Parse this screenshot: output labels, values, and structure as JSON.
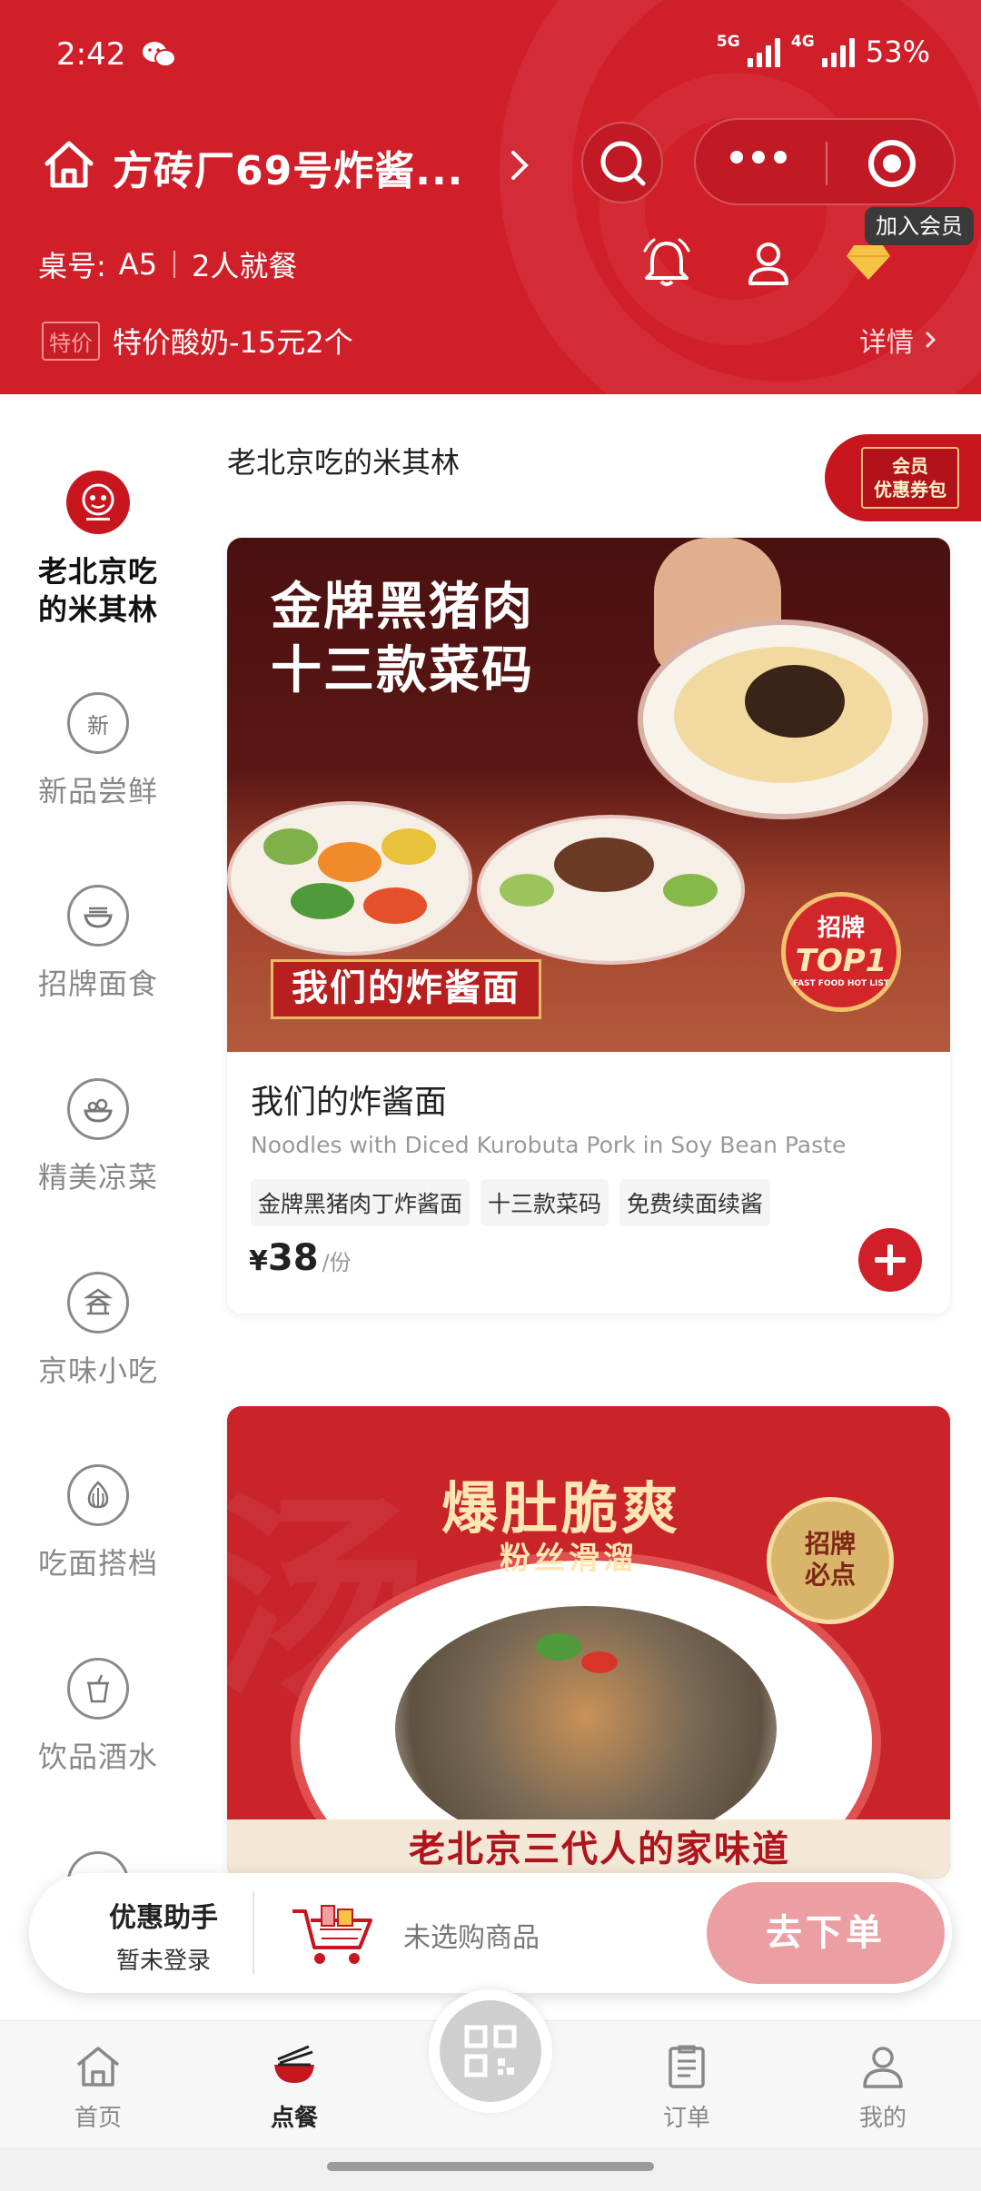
{
  "status_bar": {
    "time": "2:42",
    "net1": "5G",
    "net2": "4G",
    "battery": "53%"
  },
  "header": {
    "store_name": "方砖厂69号炸酱...",
    "join_member": "加入会员",
    "table_label": "桌号:",
    "table_no": "A5",
    "diners": "2人就餐",
    "promo_tag": "特价",
    "promo_text": "特价酸奶-15元2个",
    "details": "详情"
  },
  "sidebar": {
    "items": [
      {
        "label": "老北京吃的米其林",
        "icon": "restaurant-logo-icon",
        "active": true
      },
      {
        "label": "新品尝鲜",
        "icon_text": "新"
      },
      {
        "label": "招牌面食",
        "icon": "noodle-bowl-icon"
      },
      {
        "label": "精美凉菜",
        "icon": "salad-bowl-icon"
      },
      {
        "label": "京味小吃",
        "icon": "temple-icon"
      },
      {
        "label": "吃面搭档",
        "icon": "garlic-icon"
      },
      {
        "label": "饮品酒水",
        "icon": "drink-cup-icon"
      }
    ]
  },
  "main": {
    "section_title": "老北京吃的米其林",
    "coupon_label": "会员\n优惠券包",
    "dish1": {
      "image_title_line1": "金牌黑猪肉",
      "image_title_line2": "十三款菜码",
      "image_ribbon": "我们的炸酱面",
      "image_badge_line1": "招牌",
      "image_badge_line2": "TOP1",
      "image_badge_line3": "FAST FOOD HOT LIST",
      "name": "我们的炸酱面",
      "name_en": "Noodles with Diced Kurobuta Pork in Soy Bean Paste",
      "tags": [
        "金牌黑猪肉丁炸酱面",
        "十三款菜码",
        "免费续面续酱"
      ],
      "price_symbol": "¥",
      "price": "38",
      "unit": "/份"
    },
    "dish2": {
      "image_title": "爆肚脆爽",
      "image_subtitle": "粉丝滑溜",
      "image_badge": "招牌\n必点",
      "image_slogan": "老北京三代人的家味道"
    }
  },
  "cart": {
    "assistant_title": "优惠助手",
    "assistant_status": "暂未登录",
    "empty_text": "未选购商品",
    "order_button": "去下单"
  },
  "nav": {
    "items": [
      {
        "label": "首页",
        "icon": "home-icon"
      },
      {
        "label": "点餐",
        "icon": "noodle-bowl-icon",
        "active": true
      },
      {
        "label": "订单",
        "icon": "order-list-icon"
      },
      {
        "label": "我的",
        "icon": "person-icon"
      }
    ],
    "center_icon": "qr-scan-icon"
  },
  "colors": {
    "brand_red": "#d11f2a",
    "order_button": "#eb9fa3",
    "gold": "#f0c06d"
  }
}
